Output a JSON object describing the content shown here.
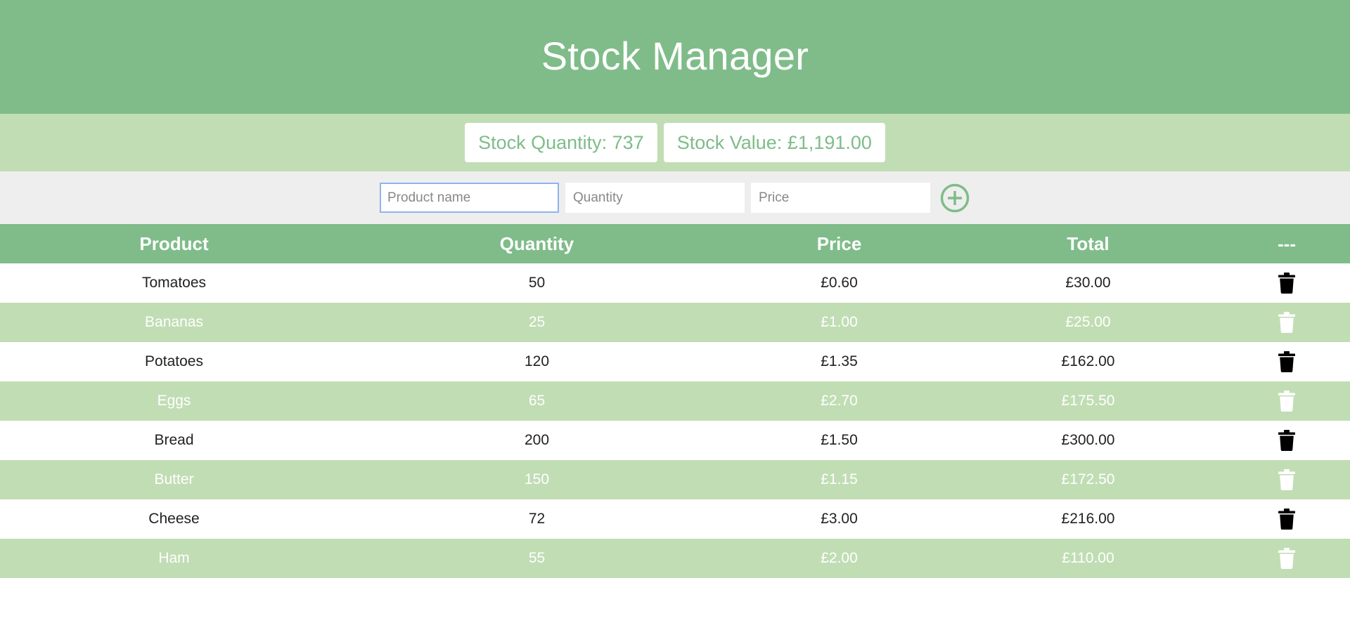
{
  "app": {
    "title": "Stock Manager"
  },
  "summary": {
    "quantity_text": "Stock Quantity: 737",
    "value_text": "Stock Value: £1,191.00"
  },
  "add_form": {
    "product_placeholder": "Product name",
    "quantity_placeholder": "Quantity",
    "price_placeholder": "Price",
    "add_icon": "plus-circle-icon"
  },
  "table": {
    "headers": [
      "Product",
      "Quantity",
      "Price",
      "Total",
      "---"
    ],
    "delete_icon": "trash-icon",
    "rows": [
      {
        "product": "Tomatoes",
        "quantity": "50",
        "price": "£0.60",
        "total": "£30.00"
      },
      {
        "product": "Bananas",
        "quantity": "25",
        "price": "£1.00",
        "total": "£25.00"
      },
      {
        "product": "Potatoes",
        "quantity": "120",
        "price": "£1.35",
        "total": "£162.00"
      },
      {
        "product": "Eggs",
        "quantity": "65",
        "price": "£2.70",
        "total": "£175.50"
      },
      {
        "product": "Bread",
        "quantity": "200",
        "price": "£1.50",
        "total": "£300.00"
      },
      {
        "product": "Butter",
        "quantity": "150",
        "price": "£1.15",
        "total": "£172.50"
      },
      {
        "product": "Cheese",
        "quantity": "72",
        "price": "£3.00",
        "total": "£216.00"
      },
      {
        "product": "Ham",
        "quantity": "55",
        "price": "£2.00",
        "total": "£110.00"
      }
    ]
  },
  "colors": {
    "primary": "#7fbc89",
    "light": "#c1ddb4",
    "form_bg": "#eeeeee",
    "focus_border": "#8fb3f0"
  }
}
